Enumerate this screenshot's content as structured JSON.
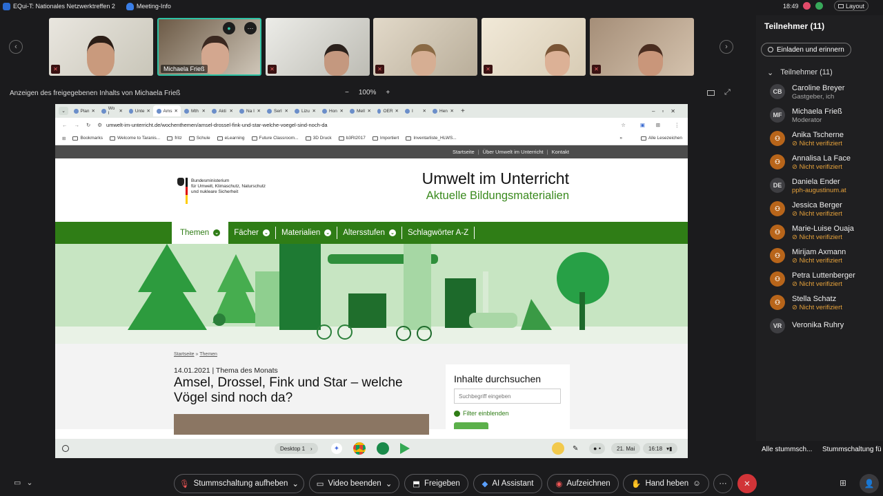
{
  "titlebar": {
    "meeting": "EQui-T: Nationales Netzwerktreffen 2",
    "info": "Meeting-Info",
    "time": "18:49",
    "layout": "Layout"
  },
  "strip": {
    "speaker_label": "Michaela Frieß"
  },
  "share": {
    "label": "Anzeigen des freigegebenen Inhalts von Michaela Frieß",
    "zoom": "100%",
    "zoom_out": "−",
    "zoom_in": "+"
  },
  "browser": {
    "tabs": [
      "Plan",
      "Wo I",
      "Unte",
      "Ams",
      "Mth",
      "Akti",
      "Na I",
      "Serl",
      "Lizu",
      "Hon",
      "Mell",
      "OER",
      "I",
      "Hen"
    ],
    "url": "umwelt-im-unterricht.de/wochenthemen/amsel-drossel-fink-und-star-welche-voegel-sind-noch-da",
    "bookmarks": [
      "Bookmarks",
      "Welcome to Taranis...",
      "fritz",
      "Schule",
      "eLearning",
      "Future Classroom...",
      "3D Druck",
      "b3Rt2017",
      "Importiert",
      "Inventarliste_HLWS..."
    ],
    "all_bookmarks": "Alle Lesezeichen"
  },
  "site": {
    "topnav": [
      "Startseite",
      "Über Umwelt im Unterricht",
      "Kontakt"
    ],
    "ministry": [
      "Bundesministerium",
      "für Umwelt, Klimaschutz, Naturschutz",
      "und nukleare Sicherheit"
    ],
    "title": "Umwelt im Unterricht",
    "subtitle": "Aktuelle Bildungsmaterialien",
    "nav": [
      "Themen",
      "Fächer",
      "Materialien",
      "Altersstufen",
      "Schlagwörter A-Z"
    ],
    "breadcrumb": [
      "Startseite",
      "»",
      "Themen"
    ],
    "meta": "14.01.2021 | Thema des Monats",
    "headline": "Amsel, Drossel, Fink und Star – welche Vögel sind noch da?",
    "search_title": "Inhalte durchsuchen",
    "search_placeholder": "Suchbegriff eingeben",
    "filter": "Filter einblenden"
  },
  "taskbar": {
    "desktop": "Desktop 1",
    "date": "21. Mai",
    "time": "16:18"
  },
  "panel": {
    "title": "Teilnehmer (11)",
    "invite": "Einladen und erinnern",
    "section": "Teilnehmer (11)",
    "participants": [
      {
        "initials": "CB",
        "name": "Caroline Breyer",
        "sub": "Gastgeber, ich"
      },
      {
        "initials": "MF",
        "name": "Michaela Frieß",
        "sub": "Moderator"
      },
      {
        "initials": "",
        "name": "Anika Tscherne",
        "sub": "Nicht verifiziert"
      },
      {
        "initials": "",
        "name": "Annalisa La Face",
        "sub": "Nicht verifiziert"
      },
      {
        "initials": "DE",
        "name": "Daniela Ender",
        "sub": "pph-augustinum.at"
      },
      {
        "initials": "",
        "name": "Jessica Berger",
        "sub": "Nicht verifiziert"
      },
      {
        "initials": "",
        "name": "Marie-Luise Ouaja",
        "sub": "Nicht verifiziert"
      },
      {
        "initials": "",
        "name": "Mirijam Axmann",
        "sub": "Nicht verifiziert"
      },
      {
        "initials": "",
        "name": "Petra Luttenberger",
        "sub": "Nicht verifiziert"
      },
      {
        "initials": "",
        "name": "Stella Schatz",
        "sub": "Nicht verifiziert"
      },
      {
        "initials": "VR",
        "name": "Veronika Ruhry",
        "sub": ""
      }
    ],
    "mute_all": "Alle stummsch...",
    "mute_all2": "Stummschaltung fü"
  },
  "controls": {
    "unmute": "Stummschaltung aufheben",
    "video": "Video beenden",
    "share": "Freigeben",
    "ai": "AI Assistant",
    "record": "Aufzeichnen",
    "hand": "Hand heben",
    "more": "···",
    "leave": "✕"
  },
  "colors": {
    "accent_green": "#2f7d16",
    "leave_red": "#d13438",
    "warning": "#e8a33b"
  }
}
